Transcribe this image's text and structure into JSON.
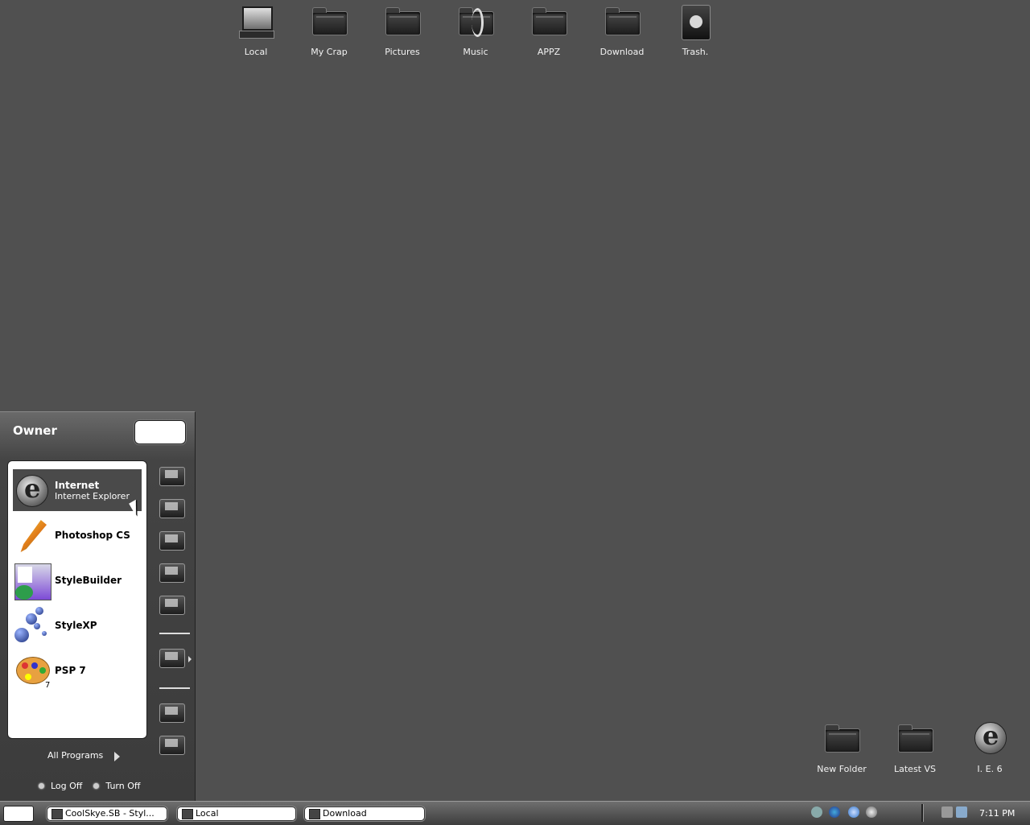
{
  "desktop": {
    "top_icons": [
      {
        "label": "Local",
        "icon": "computer-icon"
      },
      {
        "label": "My Crap",
        "icon": "documents-icon"
      },
      {
        "label": "Pictures",
        "icon": "pictures-folder-icon"
      },
      {
        "label": "Music",
        "icon": "music-folder-icon"
      },
      {
        "label": "APPZ",
        "icon": "folder-icon"
      },
      {
        "label": "Download",
        "icon": "folder-icon"
      },
      {
        "label": "Trash.",
        "icon": "recycle-bin-icon"
      }
    ],
    "bottom_icons": [
      {
        "label": "New Folder",
        "icon": "folder-icon"
      },
      {
        "label": "Latest VS",
        "icon": "folder-icon"
      },
      {
        "label": "I. E. 6",
        "icon": "internet-explorer-icon"
      }
    ]
  },
  "start_menu": {
    "user": "Owner",
    "programs": [
      {
        "name": "Internet",
        "sub": "Internet Explorer"
      },
      {
        "name": "Photoshop CS",
        "sub": ""
      },
      {
        "name": "StyleBuilder",
        "sub": ""
      },
      {
        "name": "StyleXP",
        "sub": ""
      },
      {
        "name": "PSP 7",
        "sub": ""
      }
    ],
    "psp_badge": "7",
    "all_programs": "All Programs",
    "log_off": "Log Off",
    "turn_off": "Turn Off"
  },
  "taskbar": {
    "tasks": [
      {
        "label": "CoolSkye.SB - Styl..."
      },
      {
        "label": "Local"
      },
      {
        "label": "Download"
      }
    ],
    "clock": "7:11 PM"
  }
}
